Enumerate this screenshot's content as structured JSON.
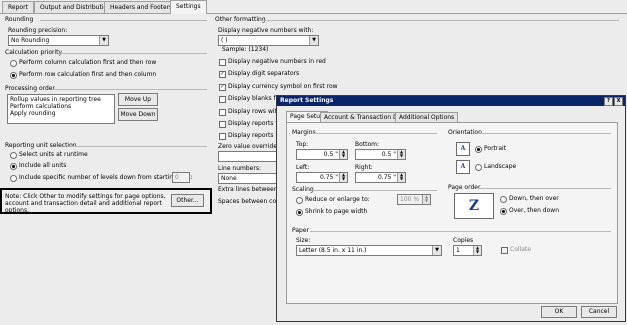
{
  "tabs": [
    "Report",
    "Output and Distribution",
    "Headers and Footers",
    "Settings"
  ],
  "rounding": {
    "title": "Rounding",
    "precision_label": "Rounding precision:",
    "precision_value": "No Rounding"
  },
  "calc": {
    "title": "Calculation priority",
    "option1": "Perform column calculation first and then row",
    "option2": "Perform row calculation first and then column"
  },
  "processing": {
    "title": "Processing order",
    "items": [
      "Rollup values in reporting tree",
      "Perform calculations",
      "Apply rounding"
    ],
    "move_up": "Move Up",
    "move_down": "Move Down"
  },
  "reporting_unit": {
    "title": "Reporting unit selection",
    "opt1": "Select units at runtime",
    "opt2": "Include all units",
    "opt3": "Include specific number of levels down from starting unit:",
    "levels": "0"
  },
  "note": {
    "text": "Note: Click Other to modify settings for page options, account and transaction detail and additional report options.",
    "button": "Other..."
  },
  "other_formatting": {
    "title": "Other formatting",
    "neg_label": "Display negative numbers with:",
    "neg_value": "( )",
    "sample": "Sample: (1234)",
    "checks": [
      "Display negative numbers in red",
      "Display digit separators",
      "Display currency symbol on first row",
      "Display blanks for ze",
      "Display rows with no",
      "Display reports with",
      "Display reports in gr"
    ],
    "zero_label": "Zero value override text",
    "line_label": "Line numbers:",
    "line_value": "None",
    "extra_label": "Extra lines between row",
    "spaces_label": "Spaces between columns"
  },
  "dialog": {
    "title": "Report Settings",
    "help": "?",
    "close": "X",
    "tabs": [
      "Page Setup",
      "Account & Transaction Detail",
      "Additional Options"
    ],
    "margins": {
      "title": "Margins",
      "top_label": "Top:",
      "top": "0.5 \"",
      "bottom_label": "Bottom:",
      "bottom": "0.5 \"",
      "left_label": "Left:",
      "left": "0.75 \"",
      "right_label": "Right:",
      "right": "0.75 \""
    },
    "orientation": {
      "title": "Orientation",
      "portrait": "Portrait",
      "landscape": "Landscape"
    },
    "scaling": {
      "title": "Scaling",
      "reduce": "Reduce or enlarge to:",
      "percent": "100 %",
      "shrink": "Shrink to page width"
    },
    "page_order": {
      "title": "Page order",
      "down_over": "Down, then over",
      "over_down": "Over, then down"
    },
    "paper": {
      "title": "Paper",
      "size_label": "Size:",
      "size_value": "Letter (8.5 in. x 11 in.)",
      "copies_label": "Copies",
      "copies": "1",
      "collate": "Collate"
    },
    "ok": "OK",
    "cancel": "Cancel"
  },
  "colors": {
    "titlebar": "#0a246a",
    "note_border": "#000000"
  }
}
